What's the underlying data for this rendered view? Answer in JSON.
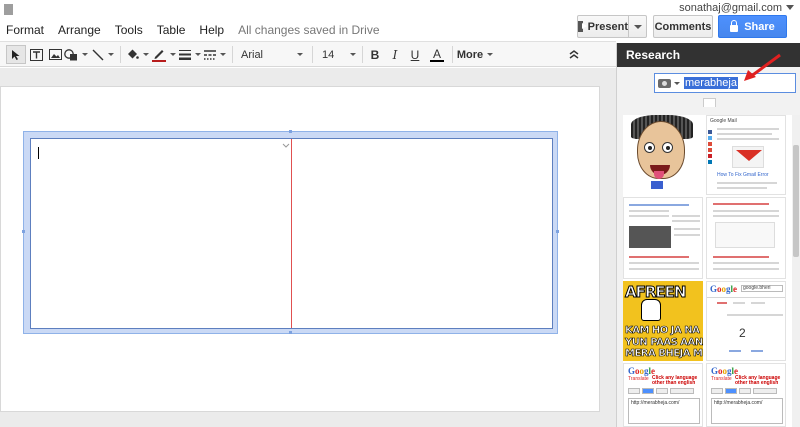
{
  "account": {
    "email": "sonathaj@gmail.com"
  },
  "menu": {
    "items": [
      "Format",
      "Arrange",
      "Tools",
      "Table",
      "Help"
    ],
    "saved_status": "All changes saved in Drive"
  },
  "header_buttons": {
    "present": "Present",
    "comments": "Comments",
    "share": "Share"
  },
  "toolbar": {
    "font": "Arial",
    "size": "14",
    "bold": "B",
    "italic": "I",
    "text_color": "A",
    "more": "More"
  },
  "research": {
    "title": "Research",
    "query": "merabheja",
    "thumbnails": {
      "gmail_title": "Google Mail",
      "gmail_caption": "How To Fix Gmail Error",
      "meme_lines": [
        "AFREEN",
        "KAM HO JA NA",
        "YUN PAAS AANA",
        "MERA BHEJA M"
      ],
      "google_word": "Google",
      "result_count": "2",
      "translate_label": "Translate",
      "click_note": "Click any language other than english",
      "url_text": "http://merabheja.com/",
      "search_term": "google.bheri"
    }
  },
  "colors": {
    "share_blue": "#4d90fe",
    "research_header": "#323232",
    "selection_blue": "#cad9f5",
    "divider_red": "#e05050",
    "arrow_red": "#e02020"
  }
}
